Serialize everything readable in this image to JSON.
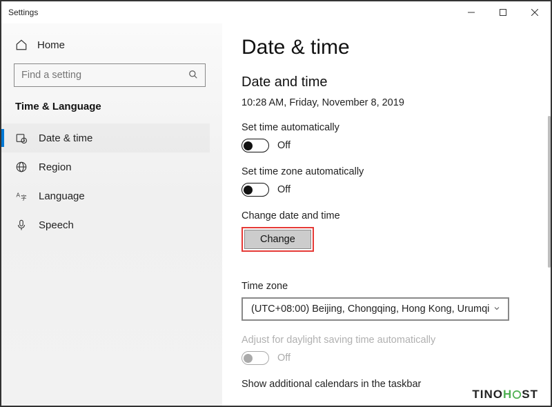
{
  "titlebar": {
    "title": "Settings"
  },
  "sidebar": {
    "home": "Home",
    "search_placeholder": "Find a setting",
    "section": "Time & Language",
    "items": [
      {
        "label": "Date & time"
      },
      {
        "label": "Region"
      },
      {
        "label": "Language"
      },
      {
        "label": "Speech"
      }
    ]
  },
  "main": {
    "title": "Date & time",
    "subtitle": "Date and time",
    "current": "10:28 AM, Friday, November 8, 2019",
    "set_time_auto_label": "Set time automatically",
    "set_time_auto_state": "Off",
    "set_tz_auto_label": "Set time zone automatically",
    "set_tz_auto_state": "Off",
    "change_label": "Change date and time",
    "change_button": "Change",
    "tz_label": "Time zone",
    "tz_value": "(UTC+08:00) Beijing, Chongqing, Hong Kong, Urumqi",
    "dst_label": "Adjust for daylight saving time automatically",
    "dst_state": "Off",
    "additional_calendars": "Show additional calendars in the taskbar"
  },
  "watermark": {
    "a": "TINO",
    "b": "H",
    "c": "ST"
  }
}
